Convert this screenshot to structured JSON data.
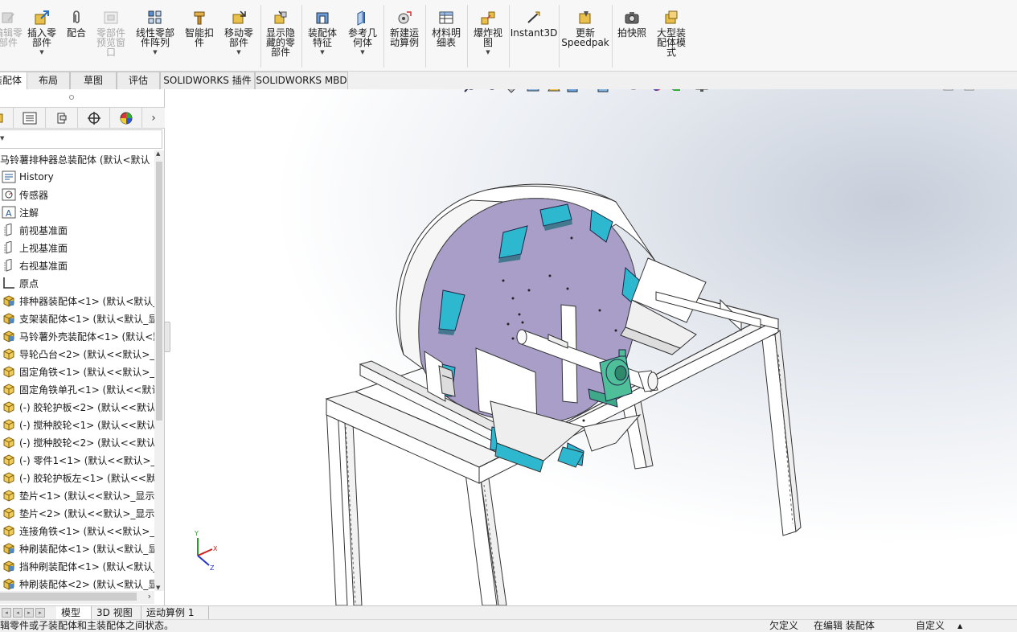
{
  "ribbon": {
    "buttons": [
      {
        "label": "编辑零\n部件",
        "dim": true
      },
      {
        "label": "插入零\n部件",
        "dropdown": true
      },
      {
        "label": "配合"
      },
      {
        "label": "零部件\n预览窗\n口",
        "dim": true
      },
      {
        "label": "线性零部\n件阵列",
        "dropdown": true
      },
      {
        "label": "智能扣\n件"
      },
      {
        "label": "移动零\n部件",
        "dropdown": true
      },
      {
        "label": "显示隐\n藏的零\n部件"
      },
      {
        "label": "装配体\n特征",
        "dropdown": true
      },
      {
        "label": "参考几\n何体",
        "dropdown": true
      },
      {
        "label": "新建运\n动算例"
      },
      {
        "label": "材料明\n细表"
      },
      {
        "label": "爆炸视\n图",
        "dropdown": true
      },
      {
        "label": "Instant3D"
      },
      {
        "label": "更新\nSpeedpak"
      },
      {
        "label": "拍快照"
      },
      {
        "label": "大型装\n配体模\n式"
      }
    ]
  },
  "tabs": [
    "装配体",
    "布局",
    "草图",
    "评估",
    "SOLIDWORKS 插件",
    "SOLIDWORKS MBD"
  ],
  "feature_tree": {
    "root": "马铃薯排种器总装配体 (默认<默认",
    "items": [
      {
        "label": "History",
        "icon": "history-icon"
      },
      {
        "label": "传感器",
        "icon": "sensor-icon"
      },
      {
        "label": "注解",
        "icon": "annotation-icon"
      },
      {
        "label": "前视基准面",
        "icon": "plane-icon"
      },
      {
        "label": "上视基准面",
        "icon": "plane-icon"
      },
      {
        "label": "右视基准面",
        "icon": "plane-icon"
      },
      {
        "label": "原点",
        "icon": "origin-icon"
      },
      {
        "label": "排种器装配体<1> (默认<默认_",
        "icon": "assembly-icon"
      },
      {
        "label": "支架装配体<1> (默认<默认_显",
        "icon": "assembly-icon"
      },
      {
        "label": "马铃薯外壳装配体<1> (默认<默",
        "icon": "assembly-icon"
      },
      {
        "label": "导轮凸台<2> (默认<<默认>_显",
        "icon": "part-icon"
      },
      {
        "label": "固定角铁<1> (默认<<默认>_显",
        "icon": "part-icon"
      },
      {
        "label": "固定角铁单孔<1> (默认<<默认",
        "icon": "part-icon"
      },
      {
        "label": "(-) 胶轮护板<2> (默认<<默认",
        "icon": "part-icon"
      },
      {
        "label": "(-) 搅种胶轮<1> (默认<<默认",
        "icon": "part-icon"
      },
      {
        "label": "(-) 搅种胶轮<2> (默认<<默认",
        "icon": "part-icon"
      },
      {
        "label": "(-) 零件1<1> (默认<<默认>_显",
        "icon": "part-icon"
      },
      {
        "label": "(-) 胶轮护板左<1> (默认<<默",
        "icon": "part-icon"
      },
      {
        "label": "垫片<1> (默认<<默认>_显示状",
        "icon": "part-icon"
      },
      {
        "label": "垫片<2> (默认<<默认>_显示状",
        "icon": "part-icon"
      },
      {
        "label": "连接角铁<1> (默认<<默认>_显",
        "icon": "part-icon"
      },
      {
        "label": "种刷装配体<1> (默认<默认_显",
        "icon": "assembly-icon"
      },
      {
        "label": "挡种刷装配体<1> (默认<默认_",
        "icon": "assembly-icon"
      },
      {
        "label": "种刷装配体<2> (默认<默认_显",
        "icon": "assembly-icon"
      }
    ]
  },
  "bottom_tabs": [
    "模型",
    "3D 视图",
    "运动算例 1"
  ],
  "status": {
    "message": "编辑零件或子装配体和主装配体之间状态。",
    "state": "欠定义",
    "mode": "在编辑 装配体",
    "custom": "自定义"
  },
  "colors": {
    "disc": "#a99ec8",
    "paddle": "#2eb8d0",
    "bearing": "#4fbf9a",
    "frame": "#ffffff"
  }
}
